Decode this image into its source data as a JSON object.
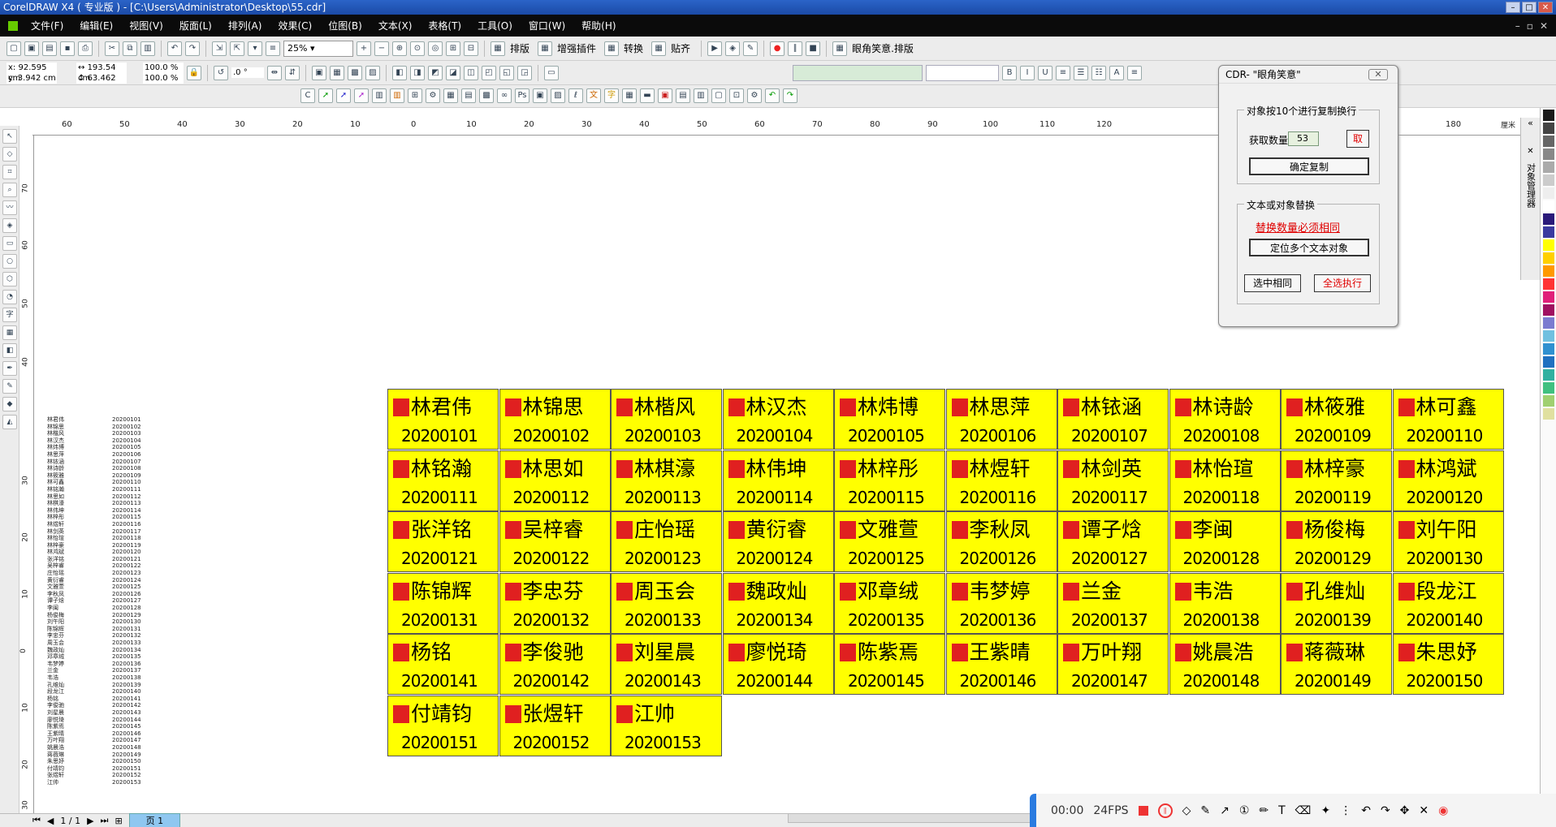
{
  "window": {
    "title": "CorelDRAW X4 ( 专业版 ) - [C:\\Users\\Administrator\\Desktop\\55.cdr]"
  },
  "menu": [
    "文件(F)",
    "编辑(E)",
    "视图(V)",
    "版面(L)",
    "排列(A)",
    "效果(C)",
    "位图(B)",
    "文本(X)",
    "表格(T)",
    "工具(O)",
    "窗口(W)",
    "帮助(H)"
  ],
  "toolbar": {
    "zoom": "25%",
    "btn_paiban": "排版",
    "btn_zengqiang": "增强插件",
    "btn_zhuanhuan": "转换",
    "btn_tiqi": "贴齐",
    "btn_yanjiao": "眼角笑意.排版"
  },
  "propbar": {
    "x": "x: 92.595 cm",
    "y": "y: 3.942 cm",
    "w": "193.54 cm",
    "h": "63.462 cm",
    "sx": "100.0",
    "sy": "100.0",
    "pct": "%",
    "angle": ".0",
    "deg": "°"
  },
  "ruler_h": [
    "60",
    "50",
    "40",
    "30",
    "20",
    "10",
    "0",
    "10",
    "20",
    "30",
    "40",
    "50",
    "60",
    "70",
    "80",
    "90",
    "100",
    "110",
    "120",
    "180"
  ],
  "ruler_h_unit": "厘米",
  "ruler_v": [
    "70",
    "60",
    "50",
    "40",
    "30",
    "20",
    "10",
    "0",
    "10",
    "20",
    "30"
  ],
  "cards": [
    {
      "name": "林君伟",
      "code": "20200101"
    },
    {
      "name": "林锦思",
      "code": "20200102"
    },
    {
      "name": "林楷风",
      "code": "20200103"
    },
    {
      "name": "林汉杰",
      "code": "20200104"
    },
    {
      "name": "林炜博",
      "code": "20200105"
    },
    {
      "name": "林思萍",
      "code": "20200106"
    },
    {
      "name": "林铱涵",
      "code": "20200107"
    },
    {
      "name": "林诗龄",
      "code": "20200108"
    },
    {
      "name": "林筱雅",
      "code": "20200109"
    },
    {
      "name": "林可鑫",
      "code": "20200110"
    },
    {
      "name": "林铭瀚",
      "code": "20200111"
    },
    {
      "name": "林思如",
      "code": "20200112"
    },
    {
      "name": "林棋濠",
      "code": "20200113"
    },
    {
      "name": "林伟坤",
      "code": "20200114"
    },
    {
      "name": "林梓彤",
      "code": "20200115"
    },
    {
      "name": "林煜轩",
      "code": "20200116"
    },
    {
      "name": "林剑英",
      "code": "20200117"
    },
    {
      "name": "林怡瑄",
      "code": "20200118"
    },
    {
      "name": "林梓豪",
      "code": "20200119"
    },
    {
      "name": "林鸿斌",
      "code": "20200120"
    },
    {
      "name": "张洋铭",
      "code": "20200121"
    },
    {
      "name": "吴梓睿",
      "code": "20200122"
    },
    {
      "name": "庄怡瑶",
      "code": "20200123"
    },
    {
      "name": "黄衍睿",
      "code": "20200124"
    },
    {
      "name": "文雅萱",
      "code": "20200125"
    },
    {
      "name": "李秋凤",
      "code": "20200126"
    },
    {
      "name": "谭子焓",
      "code": "20200127"
    },
    {
      "name": "李闽",
      "code": "20200128"
    },
    {
      "name": "杨俊梅",
      "code": "20200129"
    },
    {
      "name": "刘午阳",
      "code": "20200130"
    },
    {
      "name": "陈锦辉",
      "code": "20200131"
    },
    {
      "name": "李忠芬",
      "code": "20200132"
    },
    {
      "name": "周玉会",
      "code": "20200133"
    },
    {
      "name": "魏政灿",
      "code": "20200134"
    },
    {
      "name": "邓章绒",
      "code": "20200135"
    },
    {
      "name": "韦梦婷",
      "code": "20200136"
    },
    {
      "name": "兰金",
      "code": "20200137"
    },
    {
      "name": "韦浩",
      "code": "20200138"
    },
    {
      "name": "孔维灿",
      "code": "20200139"
    },
    {
      "name": "段龙江",
      "code": "20200140"
    },
    {
      "name": "杨铭",
      "code": "20200141"
    },
    {
      "name": "李俊驰",
      "code": "20200142"
    },
    {
      "name": "刘星晨",
      "code": "20200143"
    },
    {
      "name": "廖悦琦",
      "code": "20200144"
    },
    {
      "name": "陈紫焉",
      "code": "20200145"
    },
    {
      "name": "王紫晴",
      "code": "20200146"
    },
    {
      "name": "万叶翔",
      "code": "20200147"
    },
    {
      "name": "姚晨浩",
      "code": "20200148"
    },
    {
      "name": "蒋薇琳",
      "code": "20200149"
    },
    {
      "name": "朱思妤",
      "code": "20200150"
    },
    {
      "name": "付靖钧",
      "code": "20200151"
    },
    {
      "name": "张煜轩",
      "code": "20200152"
    },
    {
      "name": "江帅",
      "code": "20200153"
    }
  ],
  "dialog": {
    "title": "CDR-  \"眼角笑意\"",
    "group1_label": "对象按10个进行复制换行",
    "count_label": "获取数量",
    "count_value": "53",
    "get_button": "取",
    "confirm_copy": "确定复制",
    "group2_label": "文本或对象替换",
    "warning": "替换数量必须相同",
    "locate_btn": "定位多个文本对象",
    "select_same": "选中相同",
    "run_all": "全选执行"
  },
  "status": {
    "page_count": "1 / 1",
    "page_tab": "页 1"
  },
  "recorder": {
    "time": "00:00",
    "fps": "24FPS"
  },
  "docker": {
    "label": "对象管理器"
  },
  "palette": [
    "#1a1a1a",
    "#444444",
    "#666666",
    "#888888",
    "#aaaaaa",
    "#cccccc",
    "#eeeeee",
    "#ffffff",
    "#2a1a7a",
    "#3a3aa0",
    "#ffff00",
    "#ffd000",
    "#ff9900",
    "#ff3333",
    "#e0207a",
    "#a01060",
    "#7b7bd0",
    "#70c0e0",
    "#3090d0",
    "#2070c0",
    "#30b0a0",
    "#40c080",
    "#a0d070",
    "#e0e0a0"
  ]
}
